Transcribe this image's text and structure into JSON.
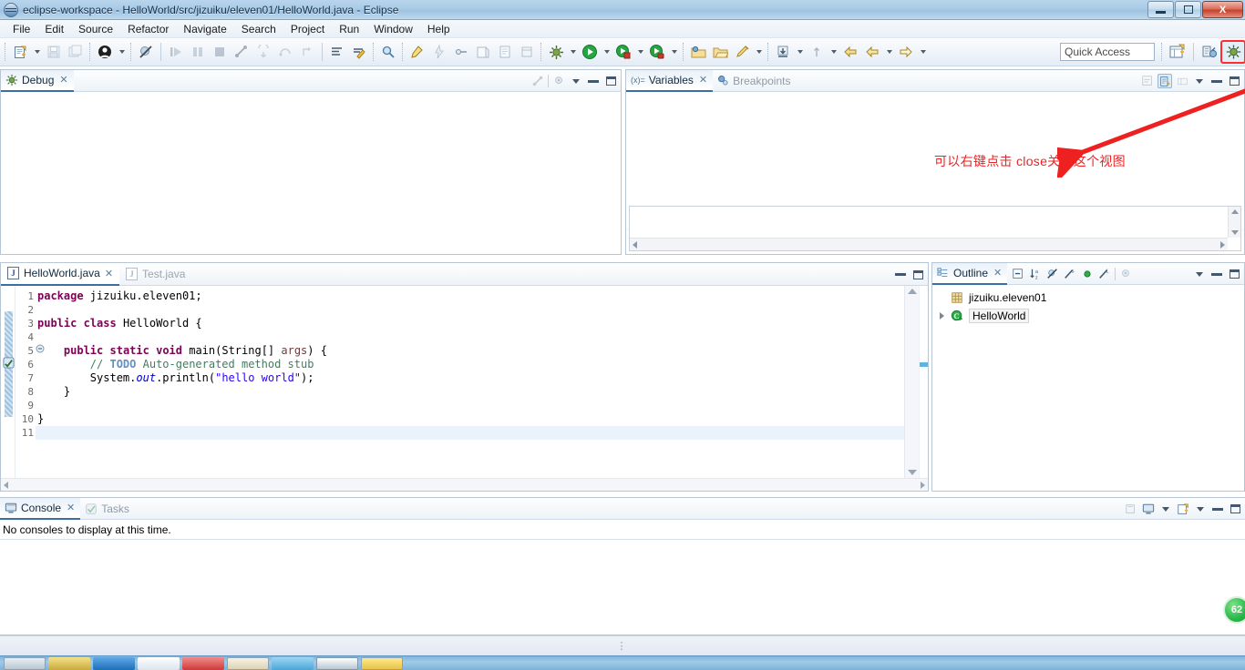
{
  "window": {
    "title": "eclipse-workspace - HelloWorld/src/jizuiku/eleven01/HelloWorld.java - Eclipse",
    "app_icon": "eclipse-icon",
    "minimize_label": "Minimize",
    "maximize_label": "Maximize",
    "close_label": "X"
  },
  "menubar": {
    "items": [
      {
        "label": "File"
      },
      {
        "label": "Edit"
      },
      {
        "label": "Source"
      },
      {
        "label": "Refactor"
      },
      {
        "label": "Navigate"
      },
      {
        "label": "Search"
      },
      {
        "label": "Project"
      },
      {
        "label": "Run"
      },
      {
        "label": "Window"
      },
      {
        "label": "Help"
      }
    ]
  },
  "toolbar": {
    "quick_access_placeholder": "Quick Access",
    "quick_access_value": "",
    "buttons": [
      {
        "name": "new-icon",
        "glyph": "new"
      },
      {
        "name": "save-icon",
        "glyph": "save"
      },
      {
        "name": "save-all-icon",
        "glyph": "saveall"
      },
      {
        "name": "skip-breakpoints-icon",
        "glyph": "skipbp"
      },
      {
        "name": "resume-icon",
        "glyph": "resume"
      },
      {
        "name": "suspend-icon",
        "glyph": "suspend"
      },
      {
        "name": "terminate-icon",
        "glyph": "terminate"
      },
      {
        "name": "disconnect-icon",
        "glyph": "disconnect"
      },
      {
        "name": "step-into-icon",
        "glyph": "stepinto"
      },
      {
        "name": "step-over-icon",
        "glyph": "stepover"
      },
      {
        "name": "step-return-icon",
        "glyph": "stepreturn"
      },
      {
        "name": "debug-icon",
        "glyph": "debug"
      },
      {
        "name": "run-icon",
        "glyph": "run"
      },
      {
        "name": "external-tools-icon",
        "glyph": "ext"
      },
      {
        "name": "new-java-package-icon",
        "glyph": "pkg"
      },
      {
        "name": "new-java-class-icon",
        "glyph": "cls"
      },
      {
        "name": "search-icon",
        "glyph": "search"
      },
      {
        "name": "last-edit-location-icon",
        "glyph": "lastedit"
      },
      {
        "name": "back-icon",
        "glyph": "back"
      },
      {
        "name": "forward-icon",
        "glyph": "forward"
      }
    ],
    "perspective_java_label": "Java",
    "perspective_debug_label": "Debug",
    "open_perspective_label": "Open Perspective"
  },
  "debug_view": {
    "tab_label": "Debug",
    "tab_icon": "debug-icon",
    "close_mark": "✕",
    "tools": [
      {
        "name": "view-menu-icon"
      },
      {
        "name": "minimize-icon"
      },
      {
        "name": "maximize-icon"
      }
    ]
  },
  "variables_view": {
    "tabs": [
      {
        "label": "Variables",
        "icon": "variables-icon",
        "active": true,
        "close_mark": "✕"
      },
      {
        "label": "Breakpoints",
        "icon": "breakpoints-icon",
        "active": false
      }
    ],
    "tools": [
      {
        "name": "collapse-all-icon"
      },
      {
        "name": "show-logical-structure-icon"
      },
      {
        "name": "layout-icon"
      },
      {
        "name": "view-menu-icon"
      },
      {
        "name": "minimize-icon"
      },
      {
        "name": "maximize-icon"
      }
    ]
  },
  "annotation": {
    "text": "可以右键点击 close关闭这个视图",
    "color": "#ee2222",
    "arrow_name": "red-arrow-annotation"
  },
  "editor": {
    "tabs": [
      {
        "label": "HelloWorld.java",
        "active": true,
        "close_mark": "✕",
        "icon": "java-file-icon"
      },
      {
        "label": "Test.java",
        "active": false,
        "icon": "java-file-icon"
      }
    ],
    "tools": [
      {
        "name": "minimize-icon"
      },
      {
        "name": "maximize-icon"
      }
    ],
    "line_numbers": [
      "1",
      "2",
      "3",
      "4",
      "5",
      "6",
      "7",
      "8",
      "9",
      "10",
      "11"
    ],
    "current_line": 11,
    "code_lines": [
      {
        "n": 1,
        "html": "<span class=\"kw\">package</span> jizuiku.eleven01;"
      },
      {
        "n": 2,
        "html": ""
      },
      {
        "n": 3,
        "html": "<span class=\"kw\">public</span> <span class=\"kw\">class</span> HelloWorld {"
      },
      {
        "n": 4,
        "html": ""
      },
      {
        "n": 5,
        "html": "    <span class=\"kw\">public</span> <span class=\"kw\">static</span> <span class=\"kw\">void</span> main(String[] <span class=\"prm\">args</span>) {"
      },
      {
        "n": 6,
        "html": "        <span class=\"cmt\">// </span><span class=\"todo\">TODO</span><span class=\"cmt\"> Auto-generated method stub</span>"
      },
      {
        "n": 7,
        "html": "        System.<span class=\"fld\">out</span>.println(<span class=\"str\">\"hello world\"</span>);"
      },
      {
        "n": 8,
        "html": "    }"
      },
      {
        "n": 9,
        "html": ""
      },
      {
        "n": 10,
        "html": "}"
      },
      {
        "n": 11,
        "html": ""
      }
    ],
    "code_plain": [
      "package jizuiku.eleven01;",
      "",
      "public class HelloWorld {",
      "",
      "    public static void main(String[] args) {",
      "        // TODO Auto-generated method stub",
      "        System.out.println(\"hello world\");",
      "    }",
      "",
      "}",
      ""
    ]
  },
  "outline_view": {
    "tab_label": "Outline",
    "tab_icon": "outline-icon",
    "close_mark": "✕",
    "tools": [
      {
        "name": "collapse-all-icon"
      },
      {
        "name": "sort-icon"
      },
      {
        "name": "hide-fields-icon"
      },
      {
        "name": "hide-static-icon"
      },
      {
        "name": "hide-non-public-icon"
      },
      {
        "name": "hide-local-types-icon"
      },
      {
        "name": "view-menu-icon"
      },
      {
        "name": "minimize-icon"
      },
      {
        "name": "maximize-icon"
      }
    ],
    "items": [
      {
        "label": "jizuiku.eleven01",
        "icon": "package-icon",
        "expandable": false,
        "selected": false
      },
      {
        "label": "HelloWorld",
        "icon": "class-icon",
        "expandable": true,
        "selected": true
      }
    ]
  },
  "console_view": {
    "tabs": [
      {
        "label": "Console",
        "icon": "console-icon",
        "active": true,
        "close_mark": "✕"
      },
      {
        "label": "Tasks",
        "icon": "tasks-icon",
        "active": false
      }
    ],
    "message": "No consoles to display at this time.",
    "tools": [
      {
        "name": "clear-console-icon"
      },
      {
        "name": "display-selected-console-icon"
      },
      {
        "name": "open-console-icon"
      },
      {
        "name": "minimize-icon"
      },
      {
        "name": "maximize-icon"
      }
    ]
  },
  "statusbar": {
    "grip": "⋮"
  },
  "overlay_badge": {
    "value": "62"
  }
}
